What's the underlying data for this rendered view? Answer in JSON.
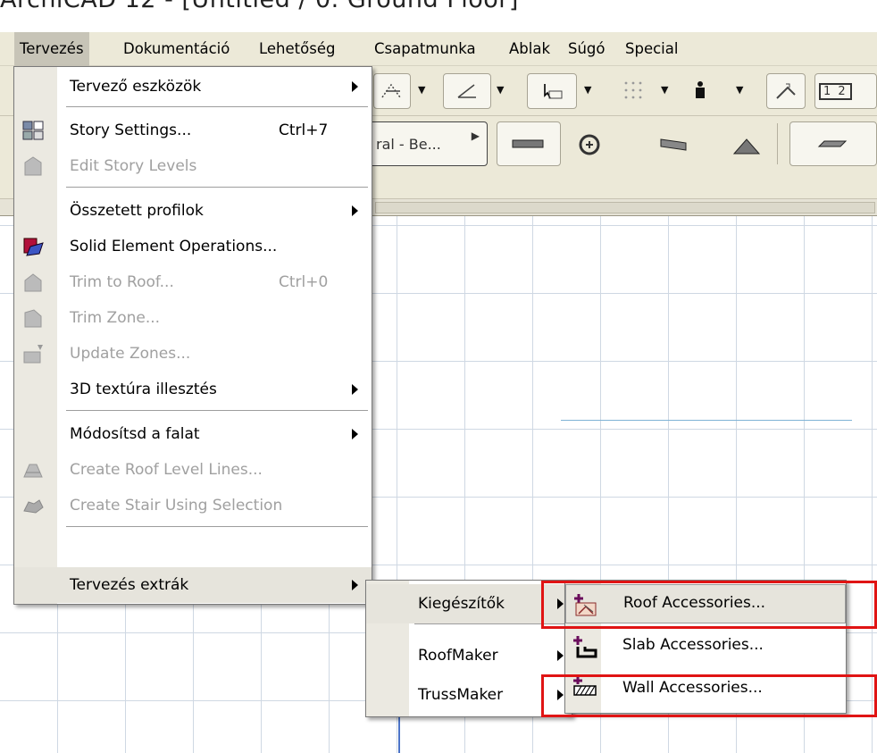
{
  "window": {
    "title": "ArchiCAD 12 - [Untitled / 0. Ground Floor]"
  },
  "menubar": {
    "items": [
      "Tervezés",
      "Dokumentáció",
      "Lehetőség",
      "Csapatmunka",
      "Ablak",
      "Súgó",
      "Special"
    ]
  },
  "toolbar": {
    "layer_combo": "ral - Be...",
    "ruler_label": "1 2"
  },
  "main_menu": {
    "items": [
      {
        "label": "Tervező eszközök",
        "submenu": true
      },
      {
        "label": "Story Settings...",
        "shortcut": "Ctrl+7"
      },
      {
        "label": "Edit Story Levels",
        "disabled": true
      },
      {
        "label": "Összetett profilok",
        "submenu": true
      },
      {
        "label": "Solid Element Operations..."
      },
      {
        "label": "Trim to Roof...",
        "shortcut": "Ctrl+0",
        "disabled": true
      },
      {
        "label": "Trim Zone...",
        "disabled": true
      },
      {
        "label": "Update Zones...",
        "disabled": true
      },
      {
        "label": "3D textúra illesztés",
        "submenu": true
      },
      {
        "label": "Módosítsd a falat",
        "submenu": true
      },
      {
        "label": "Create Roof Level Lines...",
        "disabled": true
      },
      {
        "label": "Create Stair Using Selection",
        "disabled": true
      },
      {
        "label": "Tervezés extrák",
        "submenu": true,
        "highlighted": true
      }
    ]
  },
  "submenu_extras": {
    "items": [
      {
        "label": "Kiegészítők",
        "submenu": true,
        "highlighted": true
      },
      {
        "label": "RoofMaker",
        "submenu": true
      },
      {
        "label": "TrussMaker",
        "submenu": true
      }
    ]
  },
  "submenu_accessories": {
    "items": [
      {
        "label": "Roof Accessories...",
        "icon": "roof-accessories-icon",
        "highlighted": true
      },
      {
        "label": "Slab Accessories...",
        "icon": "slab-accessories-icon"
      },
      {
        "label": "Wall Accessories...",
        "icon": "wall-accessories-icon"
      }
    ]
  },
  "colors": {
    "highlight_box": "#e01414",
    "menu_gutter": "#ebe9e1",
    "menubar": "#ece9d8"
  }
}
